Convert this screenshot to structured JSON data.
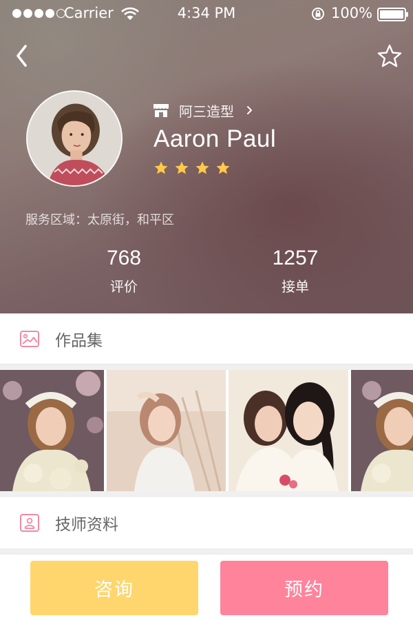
{
  "status_bar": {
    "carrier": "Carrier",
    "time": "4:34 PM",
    "battery": "100%"
  },
  "header": {
    "back_icon": "chevron-left-icon",
    "favorite_icon": "star-outline-icon"
  },
  "profile": {
    "shop_name": "阿三造型",
    "name": "Aaron Paul",
    "rating_stars": 4,
    "service_area": "服务区域：太原街，和平区"
  },
  "stats": {
    "reviews": {
      "value": "768",
      "label": "评价"
    },
    "orders": {
      "value": "1257",
      "label": "接单"
    }
  },
  "sections": {
    "portfolio": "作品集",
    "profile_info": "技师资料"
  },
  "gallery": {
    "count_visible": 4
  },
  "actions": {
    "consult": "咨询",
    "book": "预约"
  },
  "colors": {
    "consult": "#ffd66e",
    "book": "#ff839b",
    "accent_pink": "#f08aa2",
    "star": "#ffc94a"
  }
}
